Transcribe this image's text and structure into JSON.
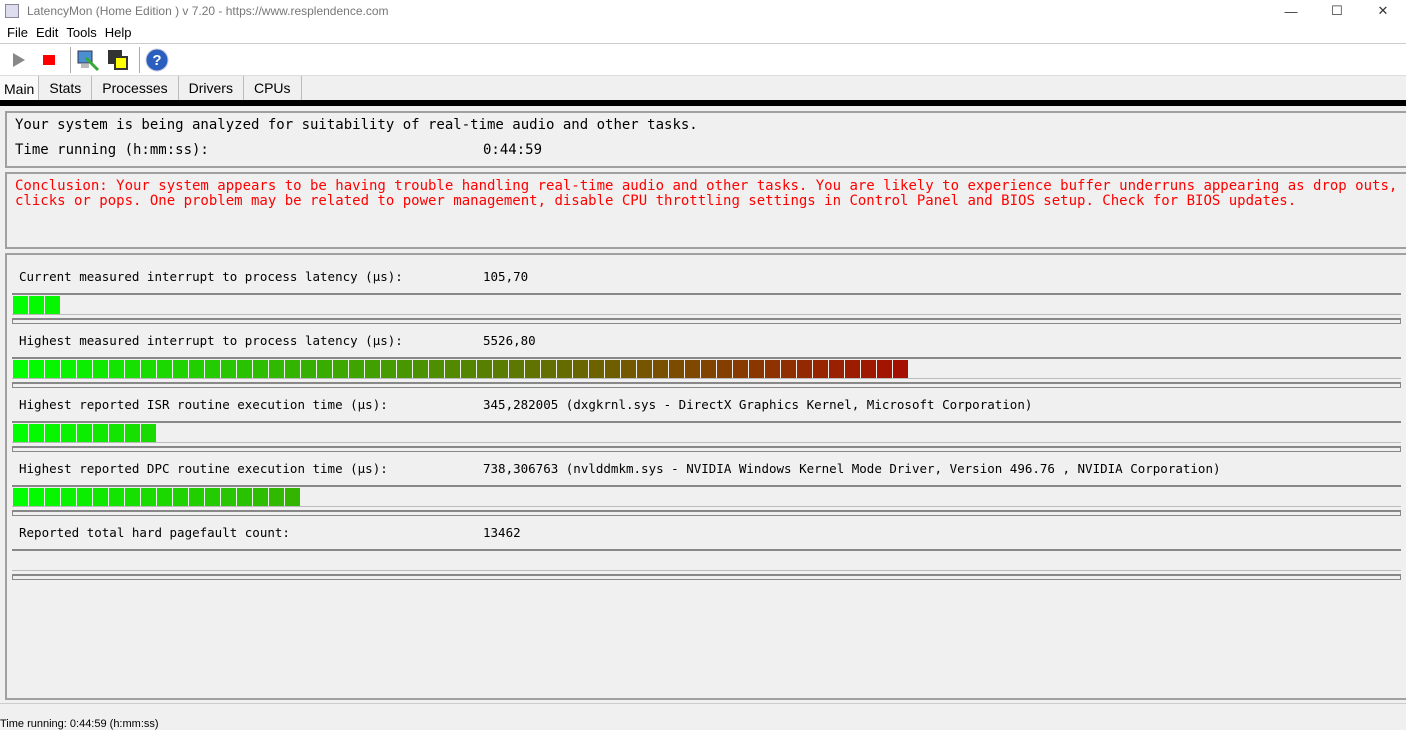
{
  "window": {
    "title": "LatencyMon  (Home Edition )  v 7.20 - https://www.resplendence.com",
    "minimize": "—",
    "maximize": "☐",
    "close": "✕"
  },
  "menu": [
    "File",
    "Edit",
    "Tools",
    "Help"
  ],
  "toolbar": {
    "icons": [
      "play-icon",
      "stop-icon",
      "analyze-icon",
      "windows-icon",
      "help-icon"
    ],
    "stop_color": "#ff0000"
  },
  "tabs": [
    "Main",
    "Stats",
    "Processes",
    "Drivers",
    "CPUs"
  ],
  "active_tab": "Main",
  "status_panel": {
    "line1": "Your system is being analyzed for suitability of real-time audio and other tasks.",
    "time_label": "Time running (h:mm:ss):",
    "time_value": "0:44:59"
  },
  "conclusion": "Conclusion: Your system appears to be having trouble handling real-time audio and other tasks. You are likely to experience buffer underruns appearing as drop outs, clicks or pops. One problem may be related to power management, disable CPU throttling settings in Control Panel and BIOS setup. Check for BIOS updates.",
  "metrics": [
    {
      "label": "Current measured interrupt to process latency (µs):",
      "value": "105,70",
      "level": 0.034
    },
    {
      "label": "Highest measured interrupt to process latency (µs):",
      "value": "5526,80",
      "level": 0.645
    },
    {
      "label": "Highest reported ISR routine execution time (µs):",
      "value": "345,282005   (dxgkrnl.sys - DirectX Graphics Kernel, Microsoft Corporation)",
      "level": 0.103
    },
    {
      "label": "Highest reported DPC routine execution time (µs):",
      "value": "738,306763   (nvlddmkm.sys - NVIDIA Windows Kernel Mode Driver, Version 496.76 , NVIDIA Corporation)",
      "level": 0.207
    },
    {
      "label": "Reported total hard pagefault count:",
      "value": "13462",
      "level": 0
    }
  ],
  "statusbar": "Time running: 0:44:59  (h:mm:ss)"
}
